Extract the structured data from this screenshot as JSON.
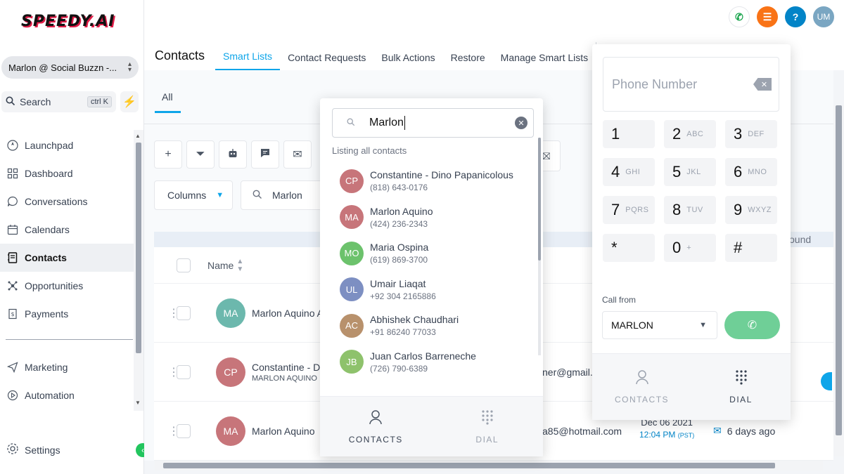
{
  "brand": {
    "logo": "SPEEDY.AI"
  },
  "sidebar": {
    "account": "Marlon @ Social Buzzn -...",
    "search_label": "Search",
    "search_shortcut": "ctrl K",
    "nav": [
      {
        "label": "Launchpad",
        "icon": "rocket-icon"
      },
      {
        "label": "Dashboard",
        "icon": "grid-icon"
      },
      {
        "label": "Conversations",
        "icon": "chat-bubble-icon"
      },
      {
        "label": "Calendars",
        "icon": "calendar-icon"
      },
      {
        "label": "Contacts",
        "icon": "contact-book-icon",
        "active": true
      },
      {
        "label": "Opportunities",
        "icon": "funnel-icon"
      },
      {
        "label": "Payments",
        "icon": "receipt-icon"
      }
    ],
    "nav2": [
      {
        "label": "Marketing",
        "icon": "send-icon"
      },
      {
        "label": "Automation",
        "icon": "play-circle-icon"
      }
    ],
    "settings_label": "Settings"
  },
  "topbar": {
    "title": "Contacts",
    "tabs": [
      "Smart Lists",
      "Contact Requests",
      "Bulk Actions",
      "Restore",
      "Manage Smart Lists"
    ],
    "active_tab": "Smart Lists",
    "user_initials": "UM",
    "help_glyph": "?"
  },
  "main": {
    "subtab": "All",
    "columns_label": "Columns",
    "search_value": "Marlon",
    "found_fragment": "ound",
    "table_header": {
      "name": "Name"
    },
    "rows": [
      {
        "initials": "MA",
        "name": "Marlon Aquino Ac",
        "color": "#6cb8ad"
      },
      {
        "initials": "CP",
        "name": "Constantine - Dinc",
        "sub": "MARLON AQUINO",
        "email": "ner@gmail.c",
        "color": "#c7757a"
      },
      {
        "initials": "MA",
        "name": "Marlon Aquino",
        "email": "a85@hotmail.com",
        "date": "Dec 06 2021",
        "time": "12:04 PM",
        "tz": "(PST)",
        "activity": "6 days ago",
        "color": "#c7757a"
      }
    ]
  },
  "search_dropdown": {
    "query": "Marlon",
    "caption": "Listing all contacts",
    "contacts": [
      {
        "initials": "CP",
        "name": "Constantine - Dino Papanicolous",
        "phone": "(818) 643-0176",
        "color": "#c7757a"
      },
      {
        "initials": "MA",
        "name": "Marlon Aquino",
        "phone": "(424) 236-2343",
        "color": "#c7757a"
      },
      {
        "initials": "MO",
        "name": "Maria Ospina",
        "phone": "(619) 869-3700",
        "color": "#6cc26c"
      },
      {
        "initials": "UL",
        "name": "Umair Liaqat",
        "phone": "+92 304 2165886",
        "color": "#7d8fc2"
      },
      {
        "initials": "AC",
        "name": "Abhishek Chaudhari",
        "phone": "+91 86240 77033",
        "color": "#b8916c"
      },
      {
        "initials": "JB",
        "name": "Juan Carlos Barreneche",
        "phone": "(726) 790-6389",
        "color": "#8ec26c"
      }
    ],
    "footer": {
      "contacts": "CONTACTS",
      "dial": "DIAL"
    }
  },
  "dialer": {
    "placeholder": "Phone Number",
    "keys": [
      {
        "digit": "1",
        "letters": ""
      },
      {
        "digit": "2",
        "letters": "ABC"
      },
      {
        "digit": "3",
        "letters": "DEF"
      },
      {
        "digit": "4",
        "letters": "GHI"
      },
      {
        "digit": "5",
        "letters": "JKL"
      },
      {
        "digit": "6",
        "letters": "MNO"
      },
      {
        "digit": "7",
        "letters": "PQRS"
      },
      {
        "digit": "8",
        "letters": "TUV"
      },
      {
        "digit": "9",
        "letters": "WXYZ"
      },
      {
        "digit": "*",
        "letters": ""
      },
      {
        "digit": "0",
        "letters": "+"
      },
      {
        "digit": "#",
        "letters": ""
      }
    ],
    "call_from_label": "Call from",
    "call_from_value": "MARLON",
    "footer": {
      "contacts": "CONTACTS",
      "dial": "DIAL"
    }
  },
  "colors": {
    "accent": "#0ea5e9",
    "call_green": "#6fcf97",
    "orange": "#f97316"
  }
}
